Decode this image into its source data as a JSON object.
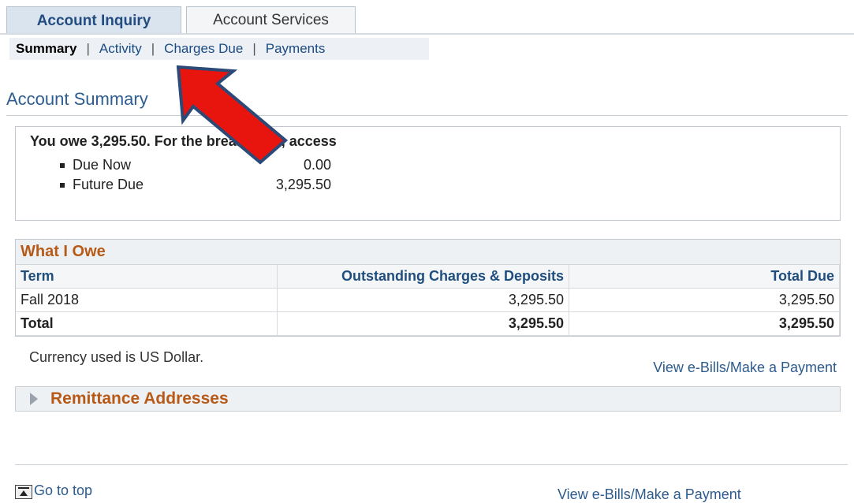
{
  "tabs": [
    {
      "label": "Account Inquiry",
      "active": true
    },
    {
      "label": "Account Services",
      "active": false
    }
  ],
  "subnav": {
    "current": "Summary",
    "separator": "|",
    "links": [
      "Activity",
      "Charges Due",
      "Payments"
    ]
  },
  "page_title": "Account Summary",
  "summary": {
    "owe_line": "You owe 3,295.50. For the breakdown, access",
    "due_now_label": "Due Now",
    "due_now_amount": "0.00",
    "future_due_label": "Future Due",
    "future_due_amount": "3,295.50"
  },
  "what_i_owe": {
    "title": "What I Owe",
    "headers": [
      "Term",
      "Outstanding Charges & Deposits",
      "Total Due"
    ],
    "rows": [
      {
        "term": "Fall 2018",
        "outstanding": "3,295.50",
        "total_due": "3,295.50"
      }
    ],
    "total": {
      "label": "Total",
      "outstanding": "3,295.50",
      "total_due": "3,295.50"
    }
  },
  "currency_note": "Currency used is US Dollar.",
  "ebill_link": "View e-Bills/Make a Payment",
  "remittance_label": "Remittance Addresses",
  "goto_top": "Go to top",
  "ebill_link_bottom": "View e-Bills/Make a Payment",
  "colors": {
    "annotation_arrow": "#e8150e",
    "annotation_outline": "#2b4a78",
    "section_heading": "#b85a17",
    "link": "#2c5b8e"
  }
}
